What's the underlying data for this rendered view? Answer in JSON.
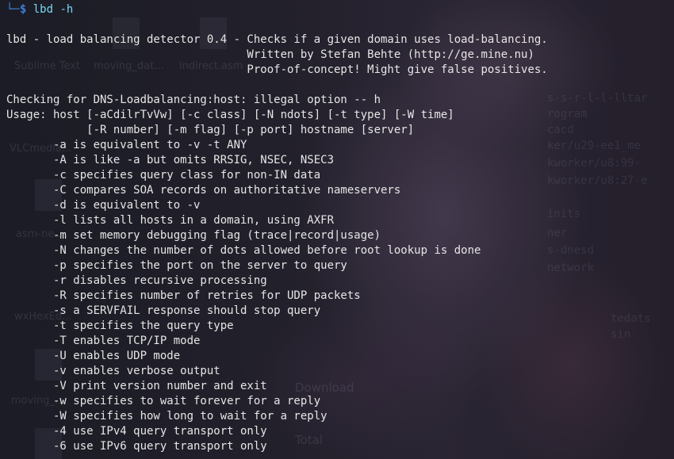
{
  "prompt": {
    "corner": "└─",
    "symbol": "$",
    "command": "lbd -h"
  },
  "output_lines": [
    "lbd - load balancing detector 0.4 - Checks if a given domain uses load-balancing.",
    "                                    Written by Stefan Behte (http://ge.mine.nu)",
    "                                    Proof-of-concept! Might give false positives.",
    "",
    "Checking for DNS-Loadbalancing:host: illegal option -- h",
    "Usage: host [-aCdilrTvVw] [-c class] [-N ndots] [-t type] [-W time]",
    "            [-R number] [-m flag] [-p port] hostname [server]",
    "       -a is equivalent to -v -t ANY",
    "       -A is like -a but omits RRSIG, NSEC, NSEC3",
    "       -c specifies query class for non-IN data",
    "       -C compares SOA records on authoritative nameservers",
    "       -d is equivalent to -v",
    "       -l lists all hosts in a domain, using AXFR",
    "       -m set memory debugging flag (trace|record|usage)",
    "       -N changes the number of dots allowed before root lookup is done",
    "       -p specifies the port on the server to query",
    "       -r disables recursive processing",
    "       -R specifies number of retries for UDP packets",
    "       -s a SERVFAIL response should stop query",
    "       -t specifies the query type",
    "       -T enables TCP/IP mode",
    "       -U enables UDP mode",
    "       -v enables verbose output",
    "       -V print version number and exit",
    "       -w specifies to wait forever for a reply",
    "       -W specifies how long to wait for a reply",
    "       -4 use IPv4 query transport only",
    "       -6 use IPv6 query transport only"
  ],
  "background_desktop": {
    "icons": [
      "Sublime Text",
      "moving_dat...",
      "indirect.asm",
      "VLCmedia...",
      "asm-ne...",
      "wxHexEd...",
      "moving_..."
    ],
    "overlay_text": [
      "Download",
      "Total"
    ]
  },
  "colors": {
    "prompt_accent": "#3f7fd6",
    "command": "#79d7f2",
    "text": "#e6e6e6",
    "background": "#1e1f29"
  }
}
